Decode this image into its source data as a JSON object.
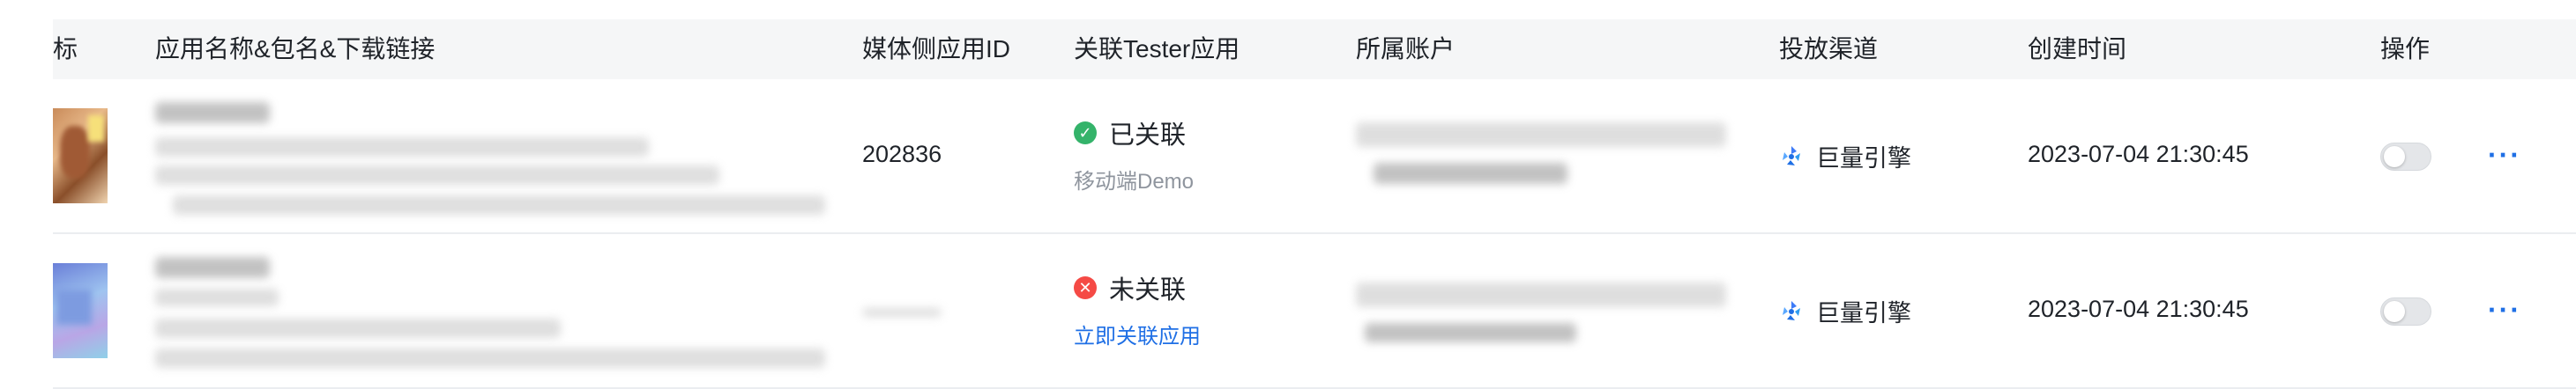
{
  "table": {
    "headers": {
      "icon": "标",
      "app_name": "应用名称&包名&下载链接",
      "media_app_id": "媒体侧应用ID",
      "tester": "关联Tester应用",
      "account": "所属账户",
      "channel": "投放渠道",
      "created": "创建时间",
      "actions": "操作"
    },
    "rows": [
      {
        "media_app_id": "202836",
        "tester_status": "已关联",
        "tester_status_icon": "check-circle-icon",
        "tester_status_color": "#34b36a",
        "tester_sub": "移动端Demo",
        "channel": "巨量引擎",
        "created": "2023-07-04 21:30:45",
        "toggle_on": false,
        "more": "···"
      },
      {
        "media_app_id": "",
        "tester_status": "未关联",
        "tester_status_icon": "close-circle-icon",
        "tester_status_color": "#f54a45",
        "tester_link": "立即关联应用",
        "channel": "巨量引擎",
        "created": "2023-07-04 21:30:45",
        "toggle_on": false,
        "more": "···"
      }
    ]
  },
  "colors": {
    "link": "#1f6fe5",
    "header_bg": "#f5f6f7",
    "divider": "#ebedf0"
  }
}
